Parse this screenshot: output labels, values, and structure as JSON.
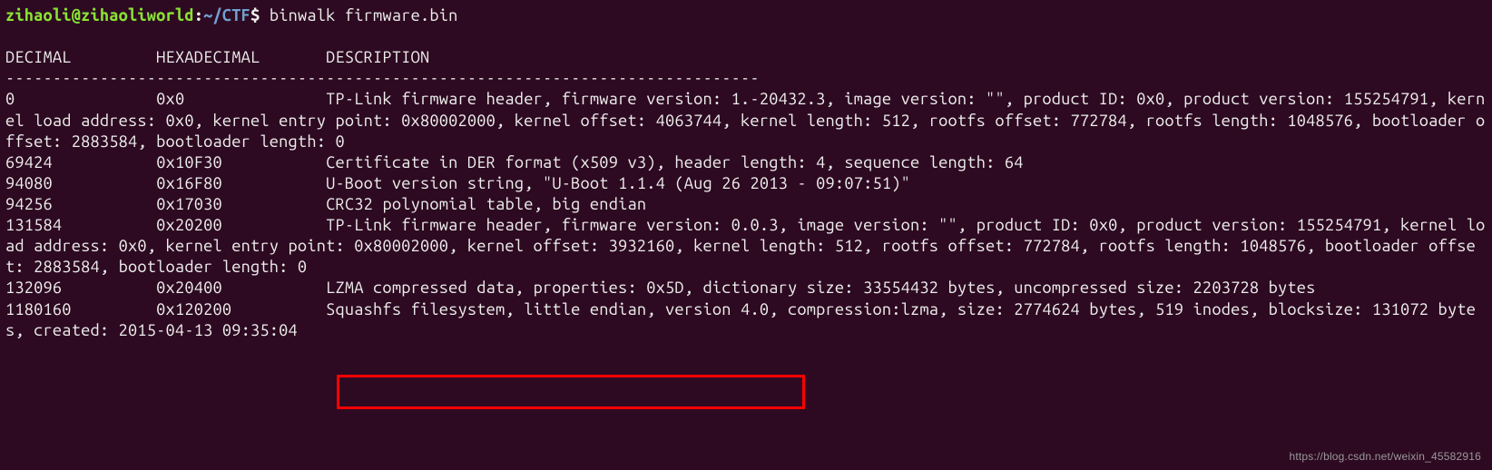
{
  "prompt": {
    "user_host": "zihaoli@zihaoliworld",
    "colon": ":",
    "path": "~/CTF",
    "dollar": "$ ",
    "command": "binwalk firmware.bin"
  },
  "blank1": "",
  "header": {
    "decimal": "DECIMAL",
    "pad1": "         ",
    "hexadecimal": "HEXADECIMAL",
    "pad2": "       ",
    "description": "DESCRIPTION"
  },
  "divider": "--------------------------------------------------------------------------------",
  "row0": {
    "dec": "0",
    "pad1": "               ",
    "hex": "0x0",
    "pad2": "               ",
    "desc": "TP-Link firmware header, firmware version: 1.-20432.3, image version: \"\", product ID: 0x0, product version: 155254791, kernel load address: 0x0, kernel entry point: 0x80002000, kernel offset: 4063744, kernel length: 512, rootfs offset: 772784, rootfs length: 1048576, bootloader offset: 2883584, bootloader length: 0"
  },
  "row1": {
    "dec": "69424",
    "pad1": "           ",
    "hex": "0x10F30",
    "pad2": "           ",
    "desc": "Certificate in DER format (x509 v3), header length: 4, sequence length: 64"
  },
  "row2": {
    "dec": "94080",
    "pad1": "           ",
    "hex": "0x16F80",
    "pad2": "           ",
    "desc": "U-Boot version string, \"U-Boot 1.1.4 (Aug 26 2013 - 09:07:51)\""
  },
  "row3": {
    "dec": "94256",
    "pad1": "           ",
    "hex": "0x17030",
    "pad2": "           ",
    "desc": "CRC32 polynomial table, big endian"
  },
  "row4": {
    "dec": "131584",
    "pad1": "          ",
    "hex": "0x20200",
    "pad2": "           ",
    "desc": "TP-Link firmware header, firmware version: 0.0.3, image version: \"\", product ID: 0x0, product version: 155254791, kernel load address: 0x0, kernel entry point: 0x80002000, kernel offset: 3932160, kernel length: 512, rootfs offset: 772784, rootfs length: 1048576, bootloader offset: 2883584, bootloader length: 0"
  },
  "row5": {
    "dec": "132096",
    "pad1": "          ",
    "hex": "0x20400",
    "pad2": "           ",
    "desc": "LZMA compressed data, properties: 0x5D, dictionary size: 33554432 bytes, uncompressed size: 2203728 bytes"
  },
  "row6": {
    "dec": "1180160",
    "pad1": "         ",
    "hex": "0x120200",
    "pad2": "          ",
    "desc": "Squashfs filesystem, little endian, version 4.0, compression:lzma, size: 2774624 bytes, 519 inodes, blocksize: 131072 bytes, created: 2015-04-13 09:35:04"
  },
  "watermark": "https://blog.csdn.net/weixin_45582916"
}
